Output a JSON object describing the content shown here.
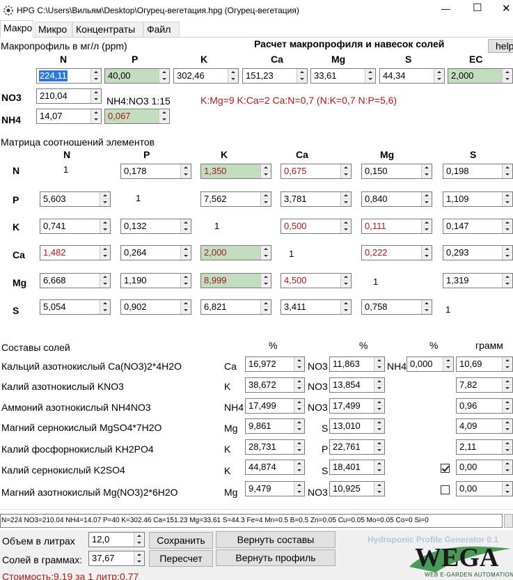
{
  "window": {
    "title": "HPG C:\\Users\\Вильям\\Desktop\\Огурец-вегетация.hpg (Огурец-вегетация)",
    "minimize": "—",
    "maximize": "☐",
    "close": "✕"
  },
  "tabs": [
    {
      "label": "Макро",
      "active": true
    },
    {
      "label": "Микро"
    },
    {
      "label": "Концентраты"
    },
    {
      "label": "Файл"
    }
  ],
  "macro": {
    "section_label": "Макропрофиль в мг/л (ppm)",
    "heading": "Расчет макропрофиля и навесок солей",
    "help": "help",
    "headers": [
      "N",
      "P",
      "K",
      "Ca",
      "Mg",
      "S",
      "EC"
    ],
    "values": [
      "224,11",
      "40,00",
      "302,46",
      "151,23",
      "33,61",
      "44,34",
      "2,000"
    ],
    "no3_label": "NO3",
    "no3": "210,04",
    "nh4_label": "NH4",
    "nh4": "14,07",
    "nh4_ratio_val": "0,067",
    "ratio_text": "NH4:NO3 1:15",
    "ratios_info": "K:Mg=9 K:Ca=2 Ca:N=0,7 (N:K=0,7 N:P=5,6)"
  },
  "matrix": {
    "label": "Матрица соотношений элементов",
    "cols": [
      "N",
      "P",
      "K",
      "Ca",
      "Mg",
      "S"
    ],
    "rows": [
      "N",
      "P",
      "K",
      "Ca",
      "Mg",
      "S"
    ],
    "cells": [
      [
        "1",
        "0,178",
        "1,350",
        "0,675",
        "0,150",
        "0,198"
      ],
      [
        "5,603",
        "1",
        "7,562",
        "3,781",
        "0,840",
        "1,109"
      ],
      [
        "0,741",
        "0,132",
        "1",
        "0,500",
        "0,111",
        "0,147"
      ],
      [
        "1,482",
        "0,264",
        "2,000",
        "1",
        "0,222",
        "0,293"
      ],
      [
        "6,668",
        "1,190",
        "8,999",
        "4,500",
        "1",
        "1,319"
      ],
      [
        "5,054",
        "0,902",
        "6,821",
        "3,411",
        "0,758",
        "1"
      ]
    ]
  },
  "salts": {
    "label": "Составы солей",
    "pct": "%",
    "gram": "грамм",
    "rows": [
      {
        "name": "Кальций азотнокислый Ca(NO3)2*4H2O",
        "e1": "Ca",
        "v1": "16,972",
        "e2": "NO3",
        "v2": "11,863",
        "e3": "NH4",
        "v3": "0,000",
        "g": "10,69"
      },
      {
        "name": "Калий азотнокислый KNO3",
        "e1": "K",
        "v1": "38,672",
        "e2": "NO3",
        "v2": "13,854",
        "g": "7,82"
      },
      {
        "name": "Аммоний азотнокислый NH4NO3",
        "e1": "NH4",
        "v1": "17,499",
        "e2": "NO3",
        "v2": "17,499",
        "g": "0,96"
      },
      {
        "name": "Магний сернокислый MgSO4*7H2O",
        "e1": "Mg",
        "v1": "9,861",
        "e2": "S",
        "v2": "13,010",
        "g": "4,09"
      },
      {
        "name": "Калий фосфорнокислый KH2PO4",
        "e1": "K",
        "v1": "28,731",
        "e2": "P",
        "v2": "22,761",
        "g": "2,11"
      },
      {
        "name": "Калий сернокислый K2SO4",
        "e1": "K",
        "v1": "44,874",
        "e2": "S",
        "v2": "18,401",
        "g": "0,00"
      },
      {
        "name": "Магний азотнокислый Mg(NO3)2*6H2O",
        "e1": "Mg",
        "v1": "9,479",
        "e2": "NO3",
        "v2": "10,925",
        "g": "0,00"
      }
    ]
  },
  "summary": "N=224 NO3=210.04 NH4=14.07 P=40 K=302.46 Ca=151.23 Mg=33.61 S=44.3 Fe=4 Mn=0.5 B=0.5 Zn=0.05 Cu=0.05 Mo=0.05 Co=0 Si=0",
  "bottom": {
    "volume_label": "Объем в литрах",
    "volume": "12,0",
    "salts_label": "Солей в граммах:",
    "salts_g": "37,67",
    "save": "Сохранить",
    "recalc": "Пересчет",
    "restore_salts": "Вернуть составы",
    "restore_profile": "Вернуть профиль",
    "cost": "Стоимость:9,19 за 1 литр:0,77",
    "brand": "Hydroponic Profile Generator 0.1",
    "logo": "WEGA",
    "logo_sub": "WEB E-GARDEN AUTOMATION"
  },
  "colors": {
    "green_field": "#c4dcc0",
    "red_text": "#9b1c1c",
    "selection": "#3178d6",
    "brand_green": "#1c6e2a"
  }
}
